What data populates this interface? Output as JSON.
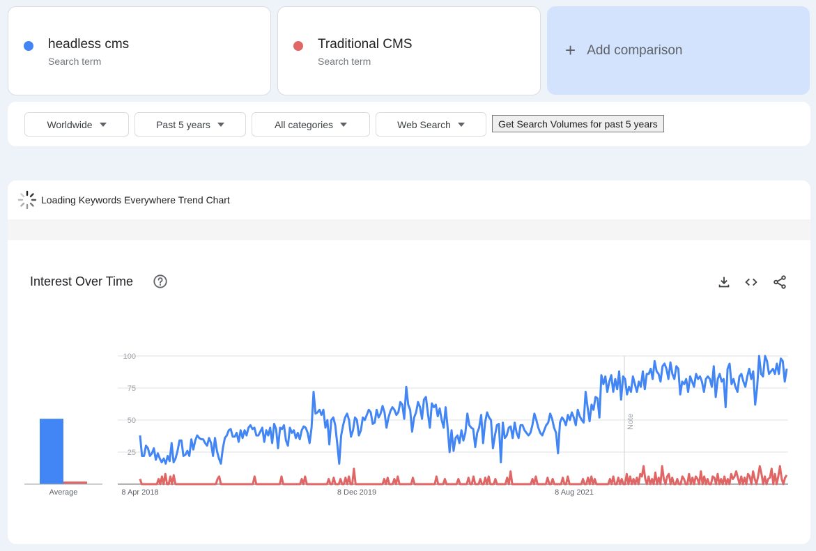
{
  "terms": [
    {
      "name": "headless cms",
      "sub": "Search term",
      "color": "#4285f4"
    },
    {
      "name": "Traditional CMS",
      "sub": "Search term",
      "color": "#e06666"
    }
  ],
  "add_comparison": "Add comparison",
  "filters": {
    "region": "Worldwide",
    "time": "Past 5 years",
    "category": "All categories",
    "search_type": "Web Search",
    "volumes_button": "Get Search Volumes for past 5 years"
  },
  "loading_text": "Loading Keywords Everywhere Trend Chart",
  "interest_title": "Interest Over Time",
  "icons": {
    "help": "help-circle-icon",
    "download": "download-icon",
    "embed": "code-embed-icon",
    "share": "share-icon"
  },
  "chart_data": {
    "type": "line",
    "yticks": [
      25,
      50,
      75,
      100
    ],
    "ylim": [
      0,
      100
    ],
    "xtick_labels": [
      "8 Apr 2018",
      "8 Dec 2019",
      "8 Aug 2021"
    ],
    "note_label": "Note",
    "average_label": "Average",
    "averages": [
      {
        "name": "headless cms",
        "value": 51
      },
      {
        "name": "Traditional CMS",
        "value": 2
      }
    ],
    "series": [
      {
        "name": "headless cms",
        "color": "#4285f4",
        "values": [
          38,
          22,
          22,
          30,
          28,
          22,
          24,
          28,
          19,
          24,
          20,
          17,
          20,
          16,
          22,
          18,
          32,
          17,
          20,
          26,
          34,
          34,
          22,
          23,
          26,
          22,
          35,
          27,
          34,
          38,
          36,
          35,
          35,
          32,
          30,
          36,
          32,
          22,
          36,
          26,
          20,
          16,
          28,
          36,
          38,
          42,
          43,
          37,
          37,
          40,
          33,
          42,
          36,
          42,
          38,
          44,
          46,
          43,
          44,
          38,
          38,
          41,
          44,
          33,
          42,
          38,
          44,
          32,
          47,
          43,
          28,
          44,
          43,
          46,
          34,
          30,
          44,
          40,
          42,
          36,
          40,
          35,
          42,
          45,
          44,
          40,
          32,
          44,
          72,
          55,
          56,
          58,
          54,
          58,
          44,
          50,
          31,
          50,
          52,
          46,
          32,
          16,
          38,
          46,
          52,
          55,
          50,
          37,
          42,
          52,
          50,
          38,
          42,
          52,
          50,
          54,
          58,
          56,
          47,
          48,
          58,
          52,
          55,
          61,
          56,
          44,
          52,
          57,
          60,
          58,
          54,
          56,
          64,
          62,
          51,
          76,
          62,
          58,
          41,
          52,
          56,
          64,
          60,
          51,
          66,
          68,
          55,
          44,
          63,
          60,
          62,
          53,
          59,
          50,
          44,
          60,
          44,
          25,
          42,
          26,
          36,
          38,
          32,
          42,
          34,
          40,
          55,
          46,
          44,
          43,
          29,
          40,
          44,
          54,
          32,
          48,
          56,
          52,
          50,
          28,
          38,
          46,
          47,
          17,
          48,
          36,
          38,
          44,
          45,
          36,
          48,
          40,
          36,
          46,
          46,
          42,
          40,
          38,
          40,
          46,
          55,
          50,
          44,
          40,
          38,
          42,
          46,
          48,
          55,
          51,
          44,
          40,
          24,
          48,
          52,
          50,
          46,
          54,
          50,
          56,
          52,
          46,
          58,
          53,
          50,
          48,
          72,
          60,
          49,
          62,
          58,
          68,
          67,
          52,
          85,
          78,
          84,
          72,
          80,
          85,
          72,
          82,
          74,
          88,
          66,
          84,
          82,
          70,
          76,
          72,
          84,
          78,
          72,
          80,
          76,
          88,
          74,
          86,
          86,
          90,
          82,
          96,
          88,
          86,
          80,
          92,
          94,
          90,
          82,
          95,
          86,
          82,
          92,
          90,
          70,
          80,
          78,
          82,
          72,
          84,
          80,
          76,
          86,
          82,
          84,
          80,
          72,
          82,
          84,
          82,
          76,
          92,
          68,
          82,
          86,
          80,
          82,
          60,
          90,
          94,
          78,
          82,
          76,
          72,
          84,
          86,
          80,
          76,
          84,
          90,
          82,
          88,
          62,
          76,
          100,
          86,
          84,
          100,
          96,
          86,
          88,
          90,
          86,
          94,
          86,
          98,
          96,
          80,
          90
        ]
      },
      {
        "name": "Traditional CMS",
        "color": "#e06666",
        "values": [
          4,
          0,
          0,
          0,
          0,
          0,
          0,
          0,
          0,
          0,
          0,
          4,
          0,
          6,
          0,
          8,
          0,
          0,
          6,
          0,
          7,
          0,
          0,
          0,
          0,
          0,
          0,
          0,
          0,
          0,
          0,
          0,
          0,
          0,
          0,
          0,
          0,
          0,
          0,
          0,
          0,
          0,
          0,
          0,
          0,
          0,
          4,
          6,
          0,
          0,
          0,
          0,
          0,
          0,
          0,
          0,
          0,
          0,
          0,
          0,
          0,
          0,
          0,
          0,
          0,
          0,
          0,
          0,
          6,
          0,
          0,
          0,
          0,
          0,
          0,
          0,
          0,
          0,
          0,
          0,
          0,
          0,
          0,
          0,
          6,
          0,
          0,
          0,
          0,
          0,
          0,
          0,
          0,
          0,
          0,
          0,
          4,
          0,
          6,
          0,
          0,
          0,
          0,
          0,
          0,
          0,
          0,
          0,
          0,
          0,
          0,
          0,
          4,
          0,
          0,
          5,
          0,
          0,
          0,
          4,
          0,
          0,
          5,
          0,
          6,
          0,
          0,
          12,
          0,
          0,
          0,
          0,
          0,
          0,
          0,
          0,
          0,
          0,
          0,
          0,
          0,
          0,
          0,
          0,
          0,
          4,
          0,
          5,
          0,
          0,
          0,
          4,
          0,
          6,
          0,
          0,
          0,
          0,
          0,
          0,
          0,
          0,
          5,
          0,
          0,
          0,
          0,
          0,
          0,
          0,
          0,
          0,
          0,
          0,
          0,
          0,
          6,
          0,
          0,
          0,
          0,
          4,
          0,
          0,
          0,
          0,
          0,
          0,
          0,
          4,
          0,
          0,
          0,
          0,
          0,
          5,
          0,
          0,
          6,
          0,
          0,
          0,
          4,
          0,
          0,
          5,
          0,
          6,
          0,
          0,
          0,
          4,
          0,
          0,
          0,
          0,
          0,
          0,
          5,
          0,
          10,
          0,
          0,
          0,
          0,
          0,
          0,
          0,
          0,
          0,
          0,
          0,
          0,
          4,
          0,
          6,
          0,
          0,
          0,
          0,
          0,
          0,
          5,
          0,
          0,
          4,
          0,
          0,
          0,
          0,
          0,
          5,
          0,
          0,
          6,
          0,
          0,
          0,
          0,
          0,
          0,
          0,
          0,
          4,
          0,
          0,
          5,
          0,
          6,
          0,
          4,
          0,
          0,
          0,
          0,
          0,
          0,
          0,
          0,
          4,
          0,
          6,
          0,
          0,
          5,
          0,
          4,
          0,
          0,
          8,
          0,
          6,
          0,
          4,
          0,
          5,
          0,
          8,
          6,
          14,
          4,
          0,
          6,
          0,
          4,
          0,
          9,
          0,
          5,
          0,
          14,
          4,
          0,
          6,
          8,
          0,
          5,
          0,
          0,
          4,
          0,
          0,
          6,
          4,
          0,
          0,
          8,
          0,
          5,
          0,
          6,
          4,
          0,
          10,
          0,
          6,
          0,
          4,
          0,
          0,
          6,
          5,
          0,
          8,
          0,
          4,
          0,
          6,
          0,
          4,
          0,
          8,
          4,
          6,
          10,
          5,
          0,
          6,
          0,
          5,
          0,
          8,
          6,
          0,
          10,
          4,
          0,
          6,
          14,
          8,
          0,
          6,
          0,
          4,
          5,
          12,
          0,
          8,
          0,
          6,
          14,
          4,
          0,
          5,
          7
        ]
      }
    ]
  }
}
